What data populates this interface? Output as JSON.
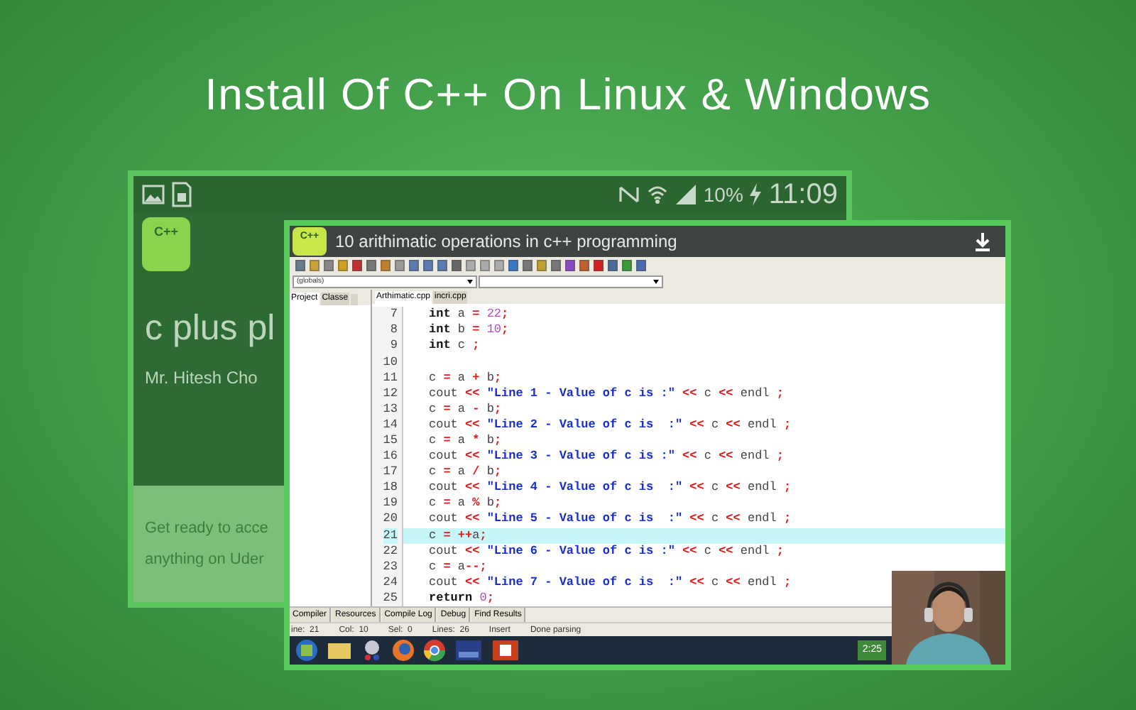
{
  "headline": "Install Of C++ On Linux & Windows",
  "phone": {
    "battery": "10%",
    "time": "11:09",
    "app_icon_text": "C++",
    "course_title": "c plus pl",
    "author": "Mr. Hitesh Cho",
    "promo_lines": [
      "Get ready to acce",
      "anything on Uder"
    ]
  },
  "video": {
    "title": "10  arithimatic operations in c++ programming",
    "app_icon_text": "C++",
    "ide": {
      "scope_dropdown": "(globals)",
      "side_tabs": [
        {
          "label": "Project",
          "selected": true
        },
        {
          "label": "Classe",
          "selected": false
        }
      ],
      "file_tabs": [
        {
          "label": "Arthimatic.cpp",
          "selected": true
        },
        {
          "label": "incri.cpp",
          "selected": false
        }
      ],
      "code_lines": [
        {
          "number": "7",
          "highlighted": false,
          "tokens": [
            {
              "kind": "kw",
              "text": "int"
            },
            {
              "kind": "id",
              "text": " a "
            },
            {
              "kind": "op",
              "text": "="
            },
            {
              "kind": "num",
              "text": " 22"
            },
            {
              "kind": "op",
              "text": ";"
            }
          ]
        },
        {
          "number": "8",
          "highlighted": false,
          "tokens": [
            {
              "kind": "kw",
              "text": "int"
            },
            {
              "kind": "id",
              "text": " b "
            },
            {
              "kind": "op",
              "text": "="
            },
            {
              "kind": "num",
              "text": " 10"
            },
            {
              "kind": "op",
              "text": ";"
            }
          ]
        },
        {
          "number": "9",
          "highlighted": false,
          "tokens": [
            {
              "kind": "kw",
              "text": "int"
            },
            {
              "kind": "id",
              "text": " c "
            },
            {
              "kind": "op",
              "text": ";"
            }
          ]
        },
        {
          "number": "10",
          "highlighted": false
        },
        {
          "number": "11",
          "highlighted": false,
          "tokens": [
            {
              "kind": "id",
              "text": "c "
            },
            {
              "kind": "op",
              "text": "="
            },
            {
              "kind": "id",
              "text": " a "
            },
            {
              "kind": "op",
              "text": "+"
            },
            {
              "kind": "id",
              "text": " b"
            },
            {
              "kind": "op",
              "text": ";"
            }
          ]
        },
        {
          "number": "12",
          "highlighted": false,
          "tokens": [
            {
              "kind": "id",
              "text": "cout "
            },
            {
              "kind": "op",
              "text": "<<"
            },
            {
              "kind": "str",
              "text": " \"Line 1 - Value of c is :\" "
            },
            {
              "kind": "op",
              "text": "<<"
            },
            {
              "kind": "id",
              "text": " c "
            },
            {
              "kind": "op",
              "text": "<<"
            },
            {
              "kind": "id",
              "text": " endl "
            },
            {
              "kind": "op",
              "text": ";"
            }
          ]
        },
        {
          "number": "13",
          "highlighted": false,
          "tokens": [
            {
              "kind": "id",
              "text": "c "
            },
            {
              "kind": "op",
              "text": "="
            },
            {
              "kind": "id",
              "text": " a "
            },
            {
              "kind": "op",
              "text": "-"
            },
            {
              "kind": "id",
              "text": " b"
            },
            {
              "kind": "op",
              "text": ";"
            }
          ]
        },
        {
          "number": "14",
          "highlighted": false,
          "tokens": [
            {
              "kind": "id",
              "text": "cout "
            },
            {
              "kind": "op",
              "text": "<<"
            },
            {
              "kind": "str",
              "text": " \"Line 2 - Value of c is  :\" "
            },
            {
              "kind": "op",
              "text": "<<"
            },
            {
              "kind": "id",
              "text": " c "
            },
            {
              "kind": "op",
              "text": "<<"
            },
            {
              "kind": "id",
              "text": " endl "
            },
            {
              "kind": "op",
              "text": ";"
            }
          ]
        },
        {
          "number": "15",
          "highlighted": false,
          "tokens": [
            {
              "kind": "id",
              "text": "c "
            },
            {
              "kind": "op",
              "text": "="
            },
            {
              "kind": "id",
              "text": " a "
            },
            {
              "kind": "op",
              "text": "*"
            },
            {
              "kind": "id",
              "text": " b"
            },
            {
              "kind": "op",
              "text": ";"
            }
          ]
        },
        {
          "number": "16",
          "highlighted": false,
          "tokens": [
            {
              "kind": "id",
              "text": "cout "
            },
            {
              "kind": "op",
              "text": "<<"
            },
            {
              "kind": "str",
              "text": " \"Line 3 - Value of c is :\" "
            },
            {
              "kind": "op",
              "text": "<<"
            },
            {
              "kind": "id",
              "text": " c "
            },
            {
              "kind": "op",
              "text": "<<"
            },
            {
              "kind": "id",
              "text": " endl "
            },
            {
              "kind": "op",
              "text": ";"
            }
          ]
        },
        {
          "number": "17",
          "highlighted": false,
          "tokens": [
            {
              "kind": "id",
              "text": "c "
            },
            {
              "kind": "op",
              "text": "="
            },
            {
              "kind": "id",
              "text": " a "
            },
            {
              "kind": "op",
              "text": "/"
            },
            {
              "kind": "id",
              "text": " b"
            },
            {
              "kind": "op",
              "text": ";"
            }
          ]
        },
        {
          "number": "18",
          "highlighted": false,
          "tokens": [
            {
              "kind": "id",
              "text": "cout "
            },
            {
              "kind": "op",
              "text": "<<"
            },
            {
              "kind": "str",
              "text": " \"Line 4 - Value of c is  :\" "
            },
            {
              "kind": "op",
              "text": "<<"
            },
            {
              "kind": "id",
              "text": " c "
            },
            {
              "kind": "op",
              "text": "<<"
            },
            {
              "kind": "id",
              "text": " endl "
            },
            {
              "kind": "op",
              "text": ";"
            }
          ]
        },
        {
          "number": "19",
          "highlighted": false,
          "tokens": [
            {
              "kind": "id",
              "text": "c "
            },
            {
              "kind": "op",
              "text": "="
            },
            {
              "kind": "id",
              "text": " a "
            },
            {
              "kind": "op",
              "text": "%"
            },
            {
              "kind": "id",
              "text": " b"
            },
            {
              "kind": "op",
              "text": ";"
            }
          ]
        },
        {
          "number": "20",
          "highlighted": false,
          "tokens": [
            {
              "kind": "id",
              "text": "cout "
            },
            {
              "kind": "op",
              "text": "<<"
            },
            {
              "kind": "str",
              "text": " \"Line 5 - Value of c is  :\" "
            },
            {
              "kind": "op",
              "text": "<<"
            },
            {
              "kind": "id",
              "text": " c "
            },
            {
              "kind": "op",
              "text": "<<"
            },
            {
              "kind": "id",
              "text": " endl "
            },
            {
              "kind": "op",
              "text": ";"
            }
          ]
        },
        {
          "number": "21",
          "highlighted": true,
          "tokens": [
            {
              "kind": "id",
              "text": "c "
            },
            {
              "kind": "op",
              "text": "= ++"
            },
            {
              "kind": "id",
              "text": "a"
            },
            {
              "kind": "op",
              "text": ";"
            }
          ]
        },
        {
          "number": "22",
          "highlighted": false,
          "tokens": [
            {
              "kind": "id",
              "text": "cout "
            },
            {
              "kind": "op",
              "text": "<<"
            },
            {
              "kind": "str",
              "text": " \"Line 6 - Value of c is :\" "
            },
            {
              "kind": "op",
              "text": "<<"
            },
            {
              "kind": "id",
              "text": " c "
            },
            {
              "kind": "op",
              "text": "<<"
            },
            {
              "kind": "id",
              "text": " endl "
            },
            {
              "kind": "op",
              "text": ";"
            }
          ]
        },
        {
          "number": "23",
          "highlighted": false,
          "tokens": [
            {
              "kind": "id",
              "text": "c "
            },
            {
              "kind": "op",
              "text": "="
            },
            {
              "kind": "id",
              "text": " a"
            },
            {
              "kind": "op",
              "text": "--;"
            }
          ]
        },
        {
          "number": "24",
          "highlighted": false,
          "tokens": [
            {
              "kind": "id",
              "text": "cout "
            },
            {
              "kind": "op",
              "text": "<<"
            },
            {
              "kind": "str",
              "text": " \"Line 7 - Value of c is  :\" "
            },
            {
              "kind": "op",
              "text": "<<"
            },
            {
              "kind": "id",
              "text": " c "
            },
            {
              "kind": "op",
              "text": "<<"
            },
            {
              "kind": "id",
              "text": " endl "
            },
            {
              "kind": "op",
              "text": ";"
            }
          ]
        },
        {
          "number": "25",
          "highlighted": false,
          "tokens": [
            {
              "kind": "kw",
              "text": "return"
            },
            {
              "kind": "num",
              "text": " 0"
            },
            {
              "kind": "op",
              "text": ";"
            }
          ]
        }
      ],
      "bottom_tabs": [
        "Compiler",
        "Resources",
        "Compile Log",
        "Debug",
        "Find Results"
      ],
      "status_bar": [
        "ine:  21",
        "Col:  10",
        "Sel:  0",
        "Lines:  26",
        "Insert",
        "Done parsing"
      ]
    },
    "taskbar_clock": "2:25"
  }
}
